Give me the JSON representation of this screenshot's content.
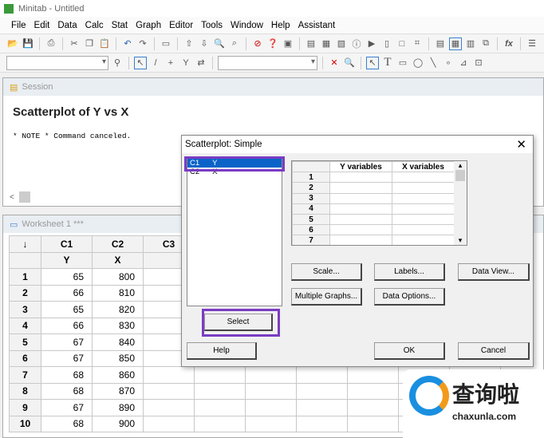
{
  "title": "Minitab - Untitled",
  "menu": [
    "File",
    "Edit",
    "Data",
    "Calc",
    "Stat",
    "Graph",
    "Editor",
    "Tools",
    "Window",
    "Help",
    "Assistant"
  ],
  "session": {
    "title": "Session",
    "heading": "Scatterplot of Y vs X",
    "note": "* NOTE * Command canceled."
  },
  "worksheet": {
    "title": "Worksheet 1 ***",
    "corner": "↓",
    "columns": [
      "C1",
      "C2",
      "C3",
      "",
      "",
      "",
      "",
      "",
      ""
    ],
    "names": [
      "Y",
      "X",
      "",
      "",
      "",
      "",
      "",
      "",
      ""
    ],
    "rows": [
      {
        "n": "1",
        "y": "65",
        "x": "800"
      },
      {
        "n": "2",
        "y": "66",
        "x": "810"
      },
      {
        "n": "3",
        "y": "65",
        "x": "820"
      },
      {
        "n": "4",
        "y": "66",
        "x": "830"
      },
      {
        "n": "5",
        "y": "67",
        "x": "840"
      },
      {
        "n": "6",
        "y": "67",
        "x": "850"
      },
      {
        "n": "7",
        "y": "68",
        "x": "860"
      },
      {
        "n": "8",
        "y": "68",
        "x": "870"
      },
      {
        "n": "9",
        "y": "67",
        "x": "890"
      },
      {
        "n": "10",
        "y": "68",
        "x": "900"
      }
    ]
  },
  "dialog": {
    "title": "Scatterplot: Simple",
    "close": "✕",
    "variables": [
      {
        "col": "C1",
        "name": "Y"
      },
      {
        "col": "C2",
        "name": "X"
      }
    ],
    "table_headers": [
      "Y variables",
      "X variables"
    ],
    "table_rows": [
      "1",
      "2",
      "3",
      "4",
      "5",
      "6",
      "7"
    ],
    "buttons": {
      "scale": "Scale...",
      "labels": "Labels...",
      "data_view": "Data View...",
      "multiple_graphs": "Multiple Graphs...",
      "data_options": "Data Options...",
      "select": "Select",
      "help": "Help",
      "ok": "OK",
      "cancel": "Cancel"
    }
  },
  "watermark": {
    "cn": "查询啦",
    "en": "chaxunla.com"
  },
  "colors": {
    "highlight": "#7a3cc4",
    "selection": "#0a64c8"
  }
}
